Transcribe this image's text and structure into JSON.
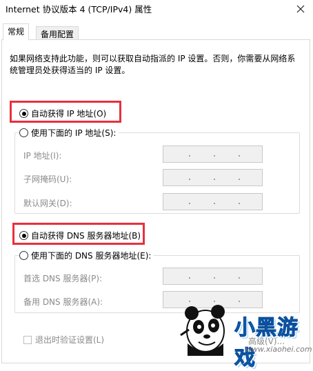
{
  "window": {
    "title": "Internet 协议版本 4 (TCP/IPv4) 属性",
    "close_icon": "close-icon"
  },
  "tabs": [
    {
      "label": "常规",
      "active": true
    },
    {
      "label": "备用配置",
      "active": false
    }
  ],
  "description": "如果网络支持此功能，则可以获取自动指派的 IP 设置。否则，你需要从网络系统管理员处获得适当的 IP 设置。",
  "ip": {
    "auto_label": "自动获得 IP 地址(O)",
    "auto_checked": true,
    "manual_label": "使用下面的 IP 地址(S):",
    "manual_checked": false,
    "fields": [
      {
        "label": "IP 地址(I):",
        "value": ". . ."
      },
      {
        "label": "子网掩码(U):",
        "value": ". . ."
      },
      {
        "label": "默认网关(D):",
        "value": ". . ."
      }
    ]
  },
  "dns": {
    "auto_label": "自动获得 DNS 服务器地址(B)",
    "auto_checked": true,
    "manual_label": "使用下面的 DNS 服务器地址(E):",
    "manual_checked": false,
    "fields": [
      {
        "label": "首选 DNS 服务器(P):",
        "value": ". . ."
      },
      {
        "label": "备用 DNS 服务器(A):",
        "value": ". . ."
      }
    ]
  },
  "validate_label": "退出时验证设置(L)",
  "advanced_label": "高级(V)...",
  "watermark": {
    "text": "小黑游戏",
    "url": "www.xiaohei.com"
  },
  "colors": {
    "highlight": "#e8303c",
    "disabled_text": "#8a8a8a",
    "field_bg": "#f0f0f0"
  }
}
